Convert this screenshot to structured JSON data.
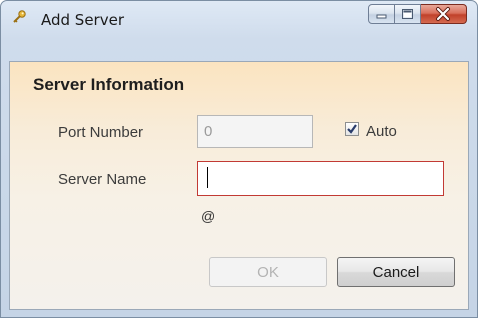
{
  "window": {
    "title": "Add Server",
    "icon": "key-icon",
    "controls": [
      "minimize-icon",
      "maximize-icon",
      "close-icon"
    ]
  },
  "section": {
    "title": "Server Information"
  },
  "fields": {
    "port": {
      "label": "Port Number",
      "value": "0",
      "enabled": false
    },
    "auto": {
      "label": "Auto",
      "checked": true
    },
    "server_name": {
      "label": "Server Name",
      "value": "",
      "focused": true
    },
    "hint": "@"
  },
  "buttons": {
    "ok": {
      "label": "OK",
      "enabled": false
    },
    "cancel": {
      "label": "Cancel",
      "enabled": true
    }
  },
  "colors": {
    "content_top": "#fbe4c0",
    "focus_border": "#c23a34",
    "close_button": "#c1412a"
  }
}
